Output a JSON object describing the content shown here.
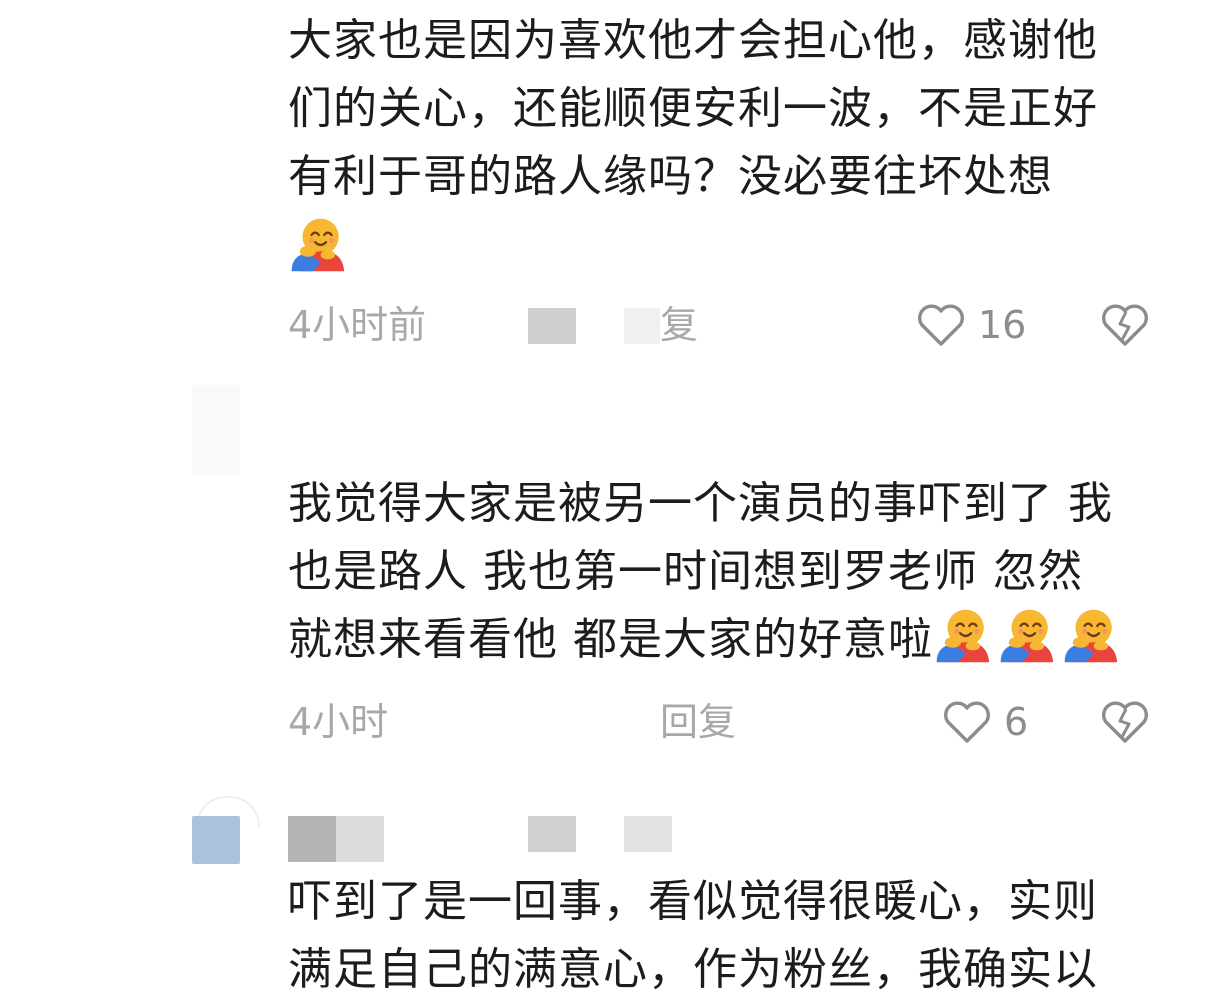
{
  "comments": [
    {
      "text": "大家也是因为喜欢他才会担心他，感谢他\n们的关心，还能顺便安利一波，不是正好\n有利于哥的路人缘吗？没必要往坏处想",
      "time": "4小时前",
      "reply": "复",
      "likes": "16"
    },
    {
      "text": "我觉得大家是被另一个演员的事吓到了 我\n也是路人 我也第一时间想到罗老师 忽然\n就想来看看他 都是大家的好意啦",
      "time": "4小时",
      "reply": "回复",
      "likes": "6"
    },
    {
      "text": "吓到了是一回事，看似觉得很暖心，实则\n满足自己的满意心，作为粉丝，我确实以",
      "time": "",
      "reply": "",
      "likes": ""
    }
  ],
  "icons": {
    "emoji": "hugging-face-emoji",
    "like": "heart-outline-icon",
    "dislike": "broken-heart-icon"
  },
  "colors": {
    "meta_text": "#a8a8a8",
    "body_text": "#1c1c1c",
    "emoji_face": "#f7b733",
    "emoji_body": "#e8453c",
    "emoji_hand": "#3b7de0"
  }
}
